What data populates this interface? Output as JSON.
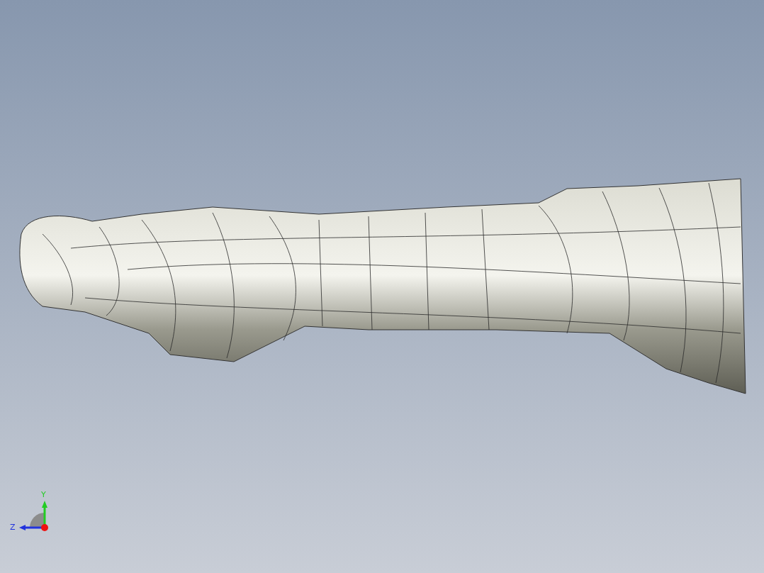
{
  "triad": {
    "axes": [
      {
        "kind": "y",
        "label": "Y",
        "color": "#22cc22"
      },
      {
        "kind": "z",
        "label": "Z",
        "color": "#2233dd"
      }
    ]
  }
}
